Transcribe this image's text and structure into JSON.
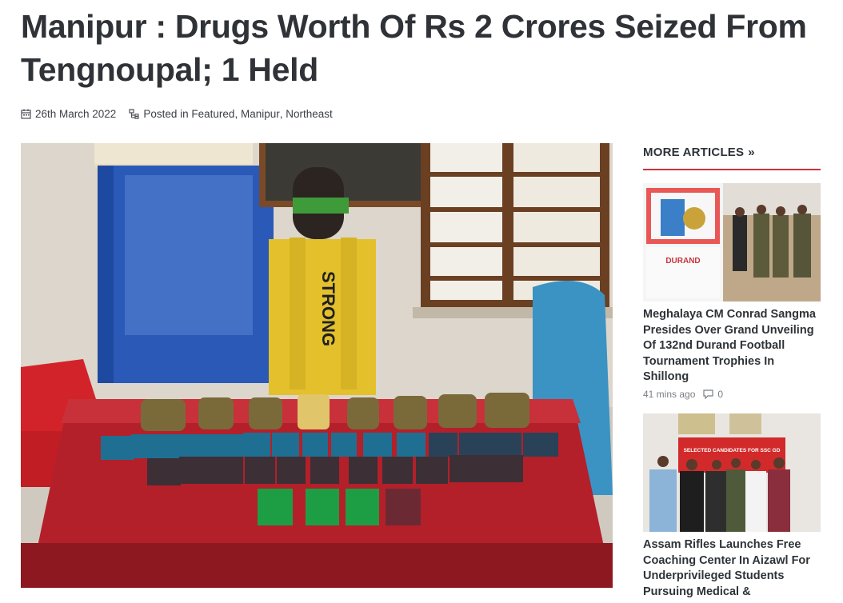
{
  "article": {
    "title": "Manipur : Drugs Worth Of Rs 2 Crores Seized From Tengnoupal; 1 Held",
    "date": "26th March 2022",
    "posted_in_label": "Posted in",
    "categories": [
      "Featured",
      "Manipur",
      "Northeast"
    ],
    "hero_shirt_text": "STRONG"
  },
  "sidebar": {
    "heading": "MORE ARTICLES",
    "heading_icon": "double-chevron-right-icon",
    "accent_color": "#c9343b",
    "articles": [
      {
        "title": "Meghalaya CM Conrad Sangma Presides Over Grand Unveiling Of 132nd Durand Football Tournament Trophies In Shillong",
        "time": "41 mins ago",
        "comments": "0",
        "thumb_text": "DURAND"
      },
      {
        "title": "Assam Rifles Launches Free Coaching Center In Aizawl For Underprivileged Students Pursuing Medical &",
        "thumb_banner": "SELECTED CANDIDATES FOR SSC GD"
      }
    ]
  }
}
